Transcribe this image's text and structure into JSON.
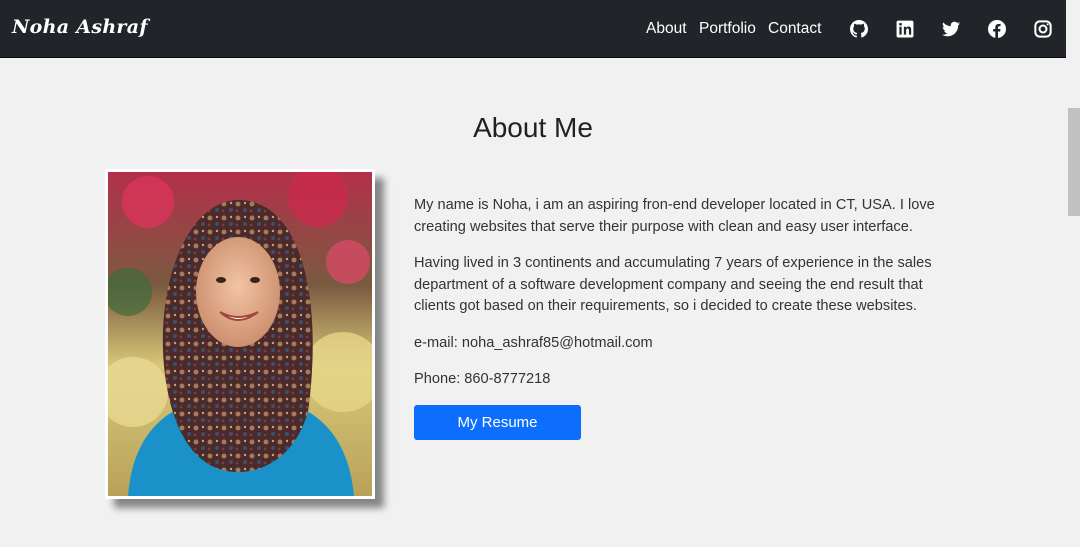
{
  "navbar": {
    "brand": "Noha Ashraf",
    "links": [
      "About",
      "Portfolio",
      "Contact"
    ],
    "social_icons": [
      "github-icon",
      "linkedin-icon",
      "twitter-icon",
      "facebook-icon",
      "instagram-icon"
    ]
  },
  "about": {
    "title": "About Me",
    "photo_icon": "profile-photo",
    "paragraphs": [
      "My name is Noha, i am an aspiring fron-end developer located in CT, USA. I love creating websites that serve their purpose with clean and easy user interface.",
      "Having lived in 3 continents and accumulating 7 years of experience in the sales department of a software development company and seeing the end result that clients got based on their requirements, so i decided to create these websites.",
      "e-mail: noha_ashraf85@hotmail.com",
      "Phone: 860-8777218"
    ],
    "button_label": "My Resume"
  },
  "colors": {
    "navbar_bg": "#212428",
    "page_bg": "#f1f1f1",
    "button_bg": "#0d6efd"
  }
}
